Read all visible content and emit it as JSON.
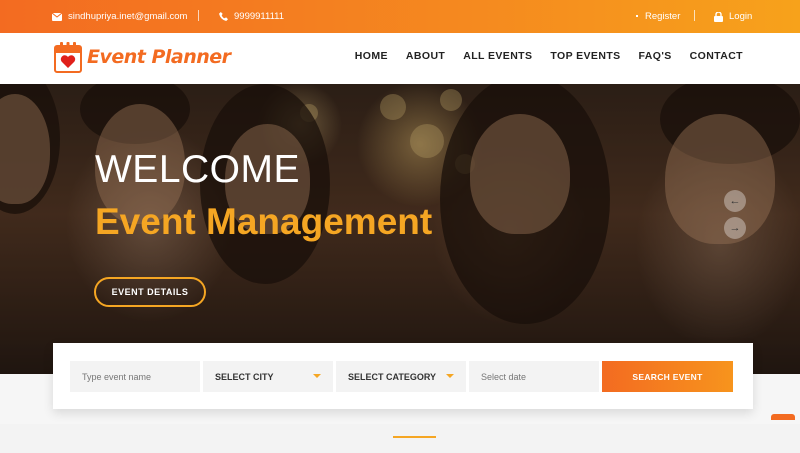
{
  "topbar": {
    "email": "sindhupriya.inet@gmail.com",
    "phone": "9999911111",
    "register": "Register",
    "login": "Login"
  },
  "brand": {
    "name": "Event Planner",
    "accent": "#f36b21",
    "accent2": "#f5a623"
  },
  "nav": {
    "items": [
      "HOME",
      "ABOUT",
      "ALL EVENTS",
      "TOP EVENTS",
      "FAQ'S",
      "CONTACT"
    ]
  },
  "hero": {
    "welcome": "WELCOME",
    "subtitle": "Event Management",
    "button": "EVENT DETAILS"
  },
  "search": {
    "event_placeholder": "Type event name",
    "city": "SELECT CITY",
    "category": "SELECT CATEGORY",
    "date_placeholder": "Select date",
    "button": "SEARCH EVENT"
  }
}
